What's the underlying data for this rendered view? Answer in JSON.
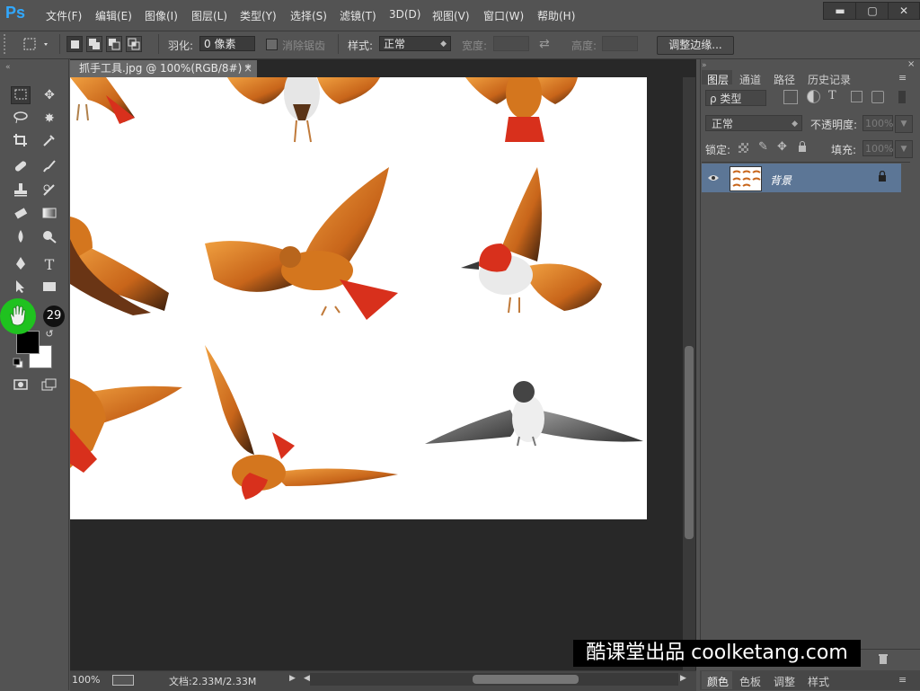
{
  "app": {
    "logo": "Ps"
  },
  "menu": [
    "文件(F)",
    "编辑(E)",
    "图像(I)",
    "图层(L)",
    "类型(Y)",
    "选择(S)",
    "滤镜(T)",
    "3D(D)",
    "视图(V)",
    "窗口(W)",
    "帮助(H)"
  ],
  "window_controls": {
    "minimize": "▬",
    "maximize": "▢",
    "close": "✕"
  },
  "options": {
    "feather_label": "羽化:",
    "feather_value": "0 像素",
    "antialias_label": "消除锯齿",
    "style_label": "样式:",
    "style_value": "正常",
    "width_label": "宽度:",
    "height_label": "高度:",
    "refine_button": "调整边缘..."
  },
  "document": {
    "tab_title": "抓手工具.jpg @ 100%(RGB/8#) *",
    "close": "×"
  },
  "status": {
    "zoom": "100%",
    "doc_info": "文档:2.33M/2.33M"
  },
  "panel": {
    "tabs": [
      "图层",
      "通道",
      "路径",
      "历史记录"
    ],
    "filter_label": "ρ 类型",
    "blend_mode": "正常",
    "opacity_label": "不透明度:",
    "opacity_value": "100%",
    "lock_label": "锁定:",
    "fill_label": "填充:",
    "fill_value": "100%",
    "layer_name": "背景"
  },
  "bottom_tabs": [
    "颜色",
    "色板",
    "调整",
    "样式"
  ],
  "overlay": {
    "badge": "29",
    "watermark": "酷课堂出品 coolketang.com"
  },
  "colors": {
    "accent_ps": "#31a8ff",
    "canvas": "#ffffff",
    "layer_selected": "#5c7696",
    "cursor_highlight": "#1fc21f",
    "bird_orange": "#d4761e",
    "bird_dark": "#3a1e0c",
    "bird_red": "#d8301c"
  }
}
